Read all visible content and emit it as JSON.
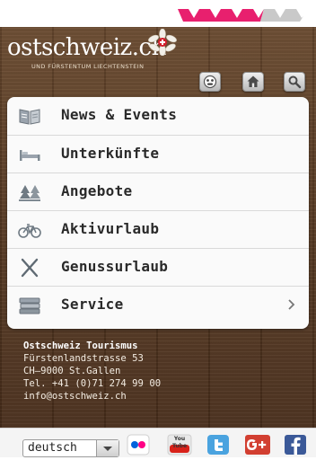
{
  "header": {
    "brand_title": "ostschweiz.ch",
    "brand_subtitle": "UND FÜRSTENTUM LIECHTENSTEIN",
    "icons": [
      "webcam-icon",
      "home-icon",
      "search-icon"
    ]
  },
  "menu": {
    "items": [
      {
        "label": "News & Events",
        "icon": "newspaper-icon"
      },
      {
        "label": "Unterkünfte",
        "icon": "bed-icon"
      },
      {
        "label": "Angebote",
        "icon": "trees-icon"
      },
      {
        "label": "Aktivurlaub",
        "icon": "bicycle-icon"
      },
      {
        "label": "Genussurlaub",
        "icon": "cutlery-icon"
      },
      {
        "label": "Service",
        "icon": "books-icon",
        "has_chevron": true
      }
    ]
  },
  "contact": {
    "name": "Ostschweiz Tourismus",
    "street": "Fürstenlandstrasse 53",
    "city": "CH–9000 St.Gallen",
    "phone": "Tel. +41 (0)71 274 99 00",
    "email": "info@ostschweiz.ch"
  },
  "footer": {
    "language_value": "deutsch",
    "youtube_text": "You Tube",
    "social_icons": [
      "flickr-icon",
      "youtube-icon",
      "twitter-icon",
      "google-plus-icon",
      "facebook-icon"
    ]
  },
  "colors": {
    "wood": "#5b3d25",
    "stripe_pink": "#e8206e",
    "menu_bg": "#fafafa",
    "text": "#2a2a2a"
  }
}
